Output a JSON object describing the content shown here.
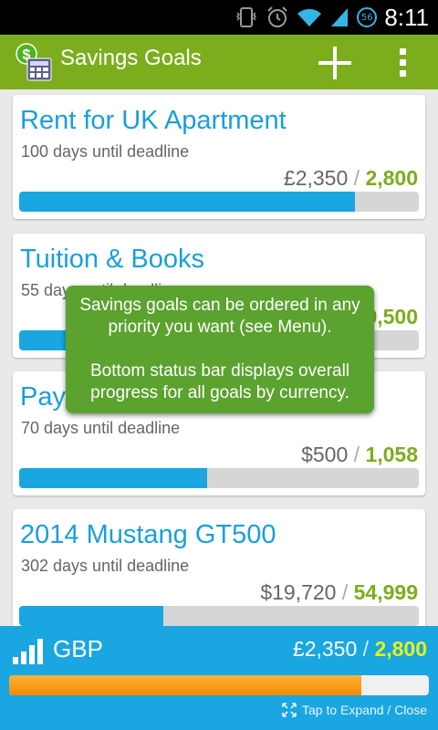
{
  "status_bar": {
    "time": "8:11",
    "notification_badge": "56",
    "icons": [
      "vibrate-icon",
      "alarm-icon",
      "wifi-icon",
      "cell-signal-icon"
    ]
  },
  "action_bar": {
    "title": "Savings Goals",
    "actions": [
      "add-icon",
      "overflow-menu-icon"
    ]
  },
  "goals": [
    {
      "name": "Rent for UK Apartment",
      "deadline": "100 days until deadline",
      "saved": "£2,350",
      "separator": "/",
      "target": "2,800",
      "progress": 0.84
    },
    {
      "name": "Tuition & Books",
      "deadline": "55 days until deadline",
      "saved": "",
      "separator": "/",
      "target": "9,500",
      "progress": 0.7
    },
    {
      "name": "Pay",
      "deadline": "70 days until deadline",
      "saved": "$500",
      "separator": "/",
      "target": "1,058",
      "progress": 0.47
    },
    {
      "name": "2014 Mustang GT500",
      "deadline": "302 days until deadline",
      "saved": "$19,720",
      "separator": "/",
      "target": "54,999",
      "progress": 0.36
    }
  ],
  "tooltip": {
    "line1": "Savings goals can be ordered in any priority you want (see Menu).",
    "line2": "Bottom status bar displays overall progress for all goals by currency."
  },
  "summary": {
    "currency": "GBP",
    "saved": "£2,350",
    "separator": "/",
    "target": "2,800",
    "progress": 0.84,
    "hint": "Tap to Expand / Close"
  },
  "colors": {
    "action_bar": "#7cad1d",
    "goal_name": "#1a9fd9",
    "target_amount": "#7cad1d",
    "progress_fill": "#1aa6e0",
    "tooltip": "#5ba22f",
    "bottom_bar": "#1aa6e0",
    "overall_fill": "#f08a00"
  }
}
